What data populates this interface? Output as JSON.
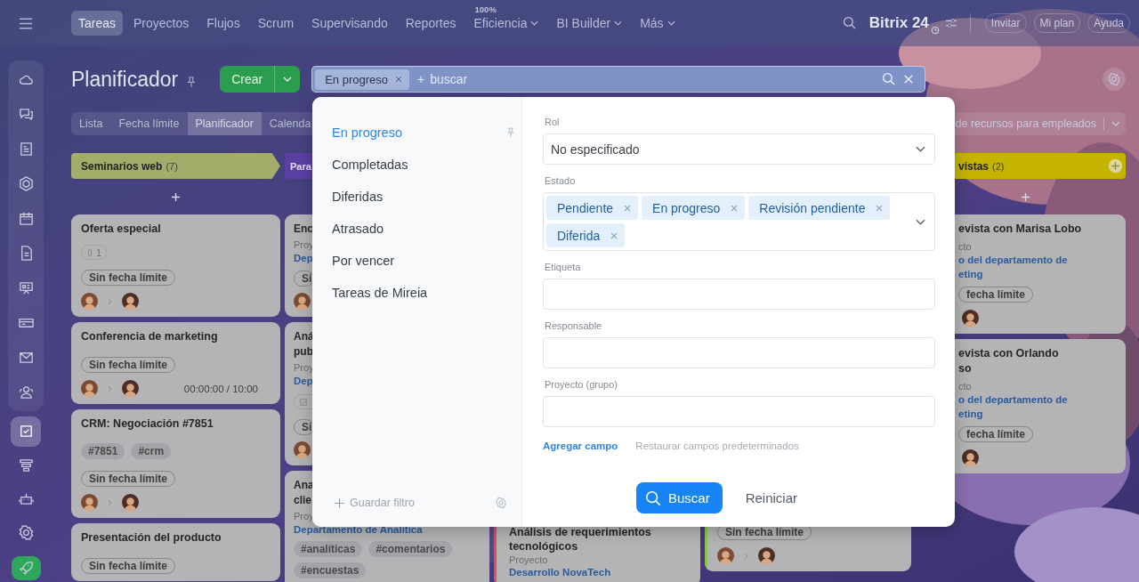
{
  "top_nav": {
    "tabs": [
      {
        "label": "Tareas",
        "selected": true,
        "dropdown": false
      },
      {
        "label": "Proyectos",
        "selected": false,
        "dropdown": false
      },
      {
        "label": "Flujos",
        "selected": false,
        "dropdown": false
      },
      {
        "label": "Scrum",
        "selected": false,
        "dropdown": false
      },
      {
        "label": "Supervisando",
        "selected": false,
        "dropdown": false
      },
      {
        "label": "Reportes",
        "selected": false,
        "dropdown": false
      },
      {
        "label": "Eficiencia",
        "badge": "100%",
        "selected": false,
        "dropdown": true
      },
      {
        "label": "BI Builder",
        "selected": false,
        "dropdown": true
      },
      {
        "label": "Más",
        "selected": false,
        "dropdown": true
      }
    ],
    "brand": "Bitrix 24",
    "buttons": [
      "Invitar",
      "Mi plan",
      "Ayuda"
    ]
  },
  "sidebar": {
    "items": [
      {
        "selected": false
      },
      {
        "selected": false
      },
      {
        "selected": false
      },
      {
        "selected": false
      },
      {
        "selected": false
      },
      {
        "selected": false
      },
      {
        "selected": false
      },
      {
        "selected": false
      },
      {
        "selected": false
      },
      {
        "selected": false
      },
      {
        "selected": true
      },
      {
        "selected": false
      },
      {
        "selected": false
      },
      {
        "selected": false
      },
      {
        "selected": false
      }
    ]
  },
  "header": {
    "title": "Planificador",
    "create_button": "Crear",
    "search": {
      "chips": [
        "En progreso"
      ],
      "plus": "+",
      "placeholder": "buscar"
    }
  },
  "views": {
    "tabs": [
      {
        "label": "Lista",
        "selected": false
      },
      {
        "label": "Fecha límite",
        "selected": false
      },
      {
        "label": "Planificador",
        "selected": true
      },
      {
        "label": "Calenda",
        "selected": false
      }
    ],
    "resource_selector": "de recursos para empleados"
  },
  "board": {
    "columns": [
      {
        "title": "Seminarios web",
        "count": "(7)",
        "color": "#a3ac69",
        "cards": [
          {
            "title_lines": [
              "Oferta especial"
            ],
            "attachments": "1",
            "deadline": "Sin fecha límite",
            "avatars": [
              {
                "kind": "creator"
              },
              {
                "kind": "responsible"
              }
            ]
          },
          {
            "title_lines": [
              "Conferencia de marketing"
            ],
            "deadline": "Sin fecha límite",
            "avatars": [
              {
                "kind": "creator"
              },
              {
                "kind": "responsible"
              }
            ],
            "timer": "00:00:00 / 10:00"
          },
          {
            "title_lines": [
              "CRM: Negociación #7851"
            ],
            "tags": [
              "#7851",
              "#crm"
            ],
            "deadline": "Sin fecha límite",
            "avatars": [
              {
                "kind": "creator"
              },
              {
                "kind": "responsible"
              }
            ]
          },
          {
            "title_lines": [
              "Presentación del producto"
            ],
            "deadline": "Sin fecha límite"
          }
        ]
      },
      {
        "title": "Para",
        "color": "#5b3fa3",
        "cards": [
          {
            "title_lines": [
              "Enc"
            ],
            "project_label": "Proy",
            "project_lines": [
              "Dep"
            ],
            "deadline": "Si",
            "avatars": [
              {
                "kind": "creator"
              }
            ]
          },
          {
            "title_lines": [
              "Aná",
              "pub"
            ],
            "project_label": "Proy",
            "project_lines": [
              "Dep"
            ],
            "checklist": true,
            "deadline": "Si",
            "avatars": [
              {
                "kind": "creator"
              }
            ]
          },
          {
            "title_lines": [
              "Ana",
              "clie"
            ],
            "project_label": "Proy",
            "project_lines": [
              "Departamento de Analítica"
            ],
            "tags": [
              "#analíticas",
              "#comentarios",
              "#encuestas"
            ]
          }
        ]
      },
      {
        "cards": [
          {
            "title_lines": [
              "Análisis de requerimientos",
              "tecnológicos"
            ],
            "project_label": "Proyecto",
            "project_lines": [
              "Desarrollo NovaTech"
            ],
            "color": "#d9534f"
          }
        ]
      },
      {
        "cards": [
          {
            "deadline": "Sin fecha límite",
            "avatars": [
              {
                "kind": "creator"
              },
              {
                "kind": "responsible"
              }
            ],
            "color": "#8bc34a"
          }
        ]
      },
      {
        "title": "vistas",
        "count": "(2)",
        "color": "#c4b400",
        "cards": [
          {
            "title_lines": [
              "evista con Marisa Lobo"
            ],
            "project_label": "cto",
            "project_lines": [
              "o del departamento de",
              "eting"
            ],
            "deadline": "fecha límite",
            "avatars": [
              {
                "kind": "responsible"
              }
            ]
          },
          {
            "title_lines": [
              "evista con Orlando",
              "so"
            ],
            "project_label": "cto",
            "project_lines": [
              "o del departamento de",
              "eting"
            ],
            "deadline": "fecha límite",
            "avatars": [
              {
                "kind": "responsible"
              }
            ]
          }
        ]
      }
    ]
  },
  "filter_popup": {
    "presets": [
      {
        "label": "En progreso",
        "selected": true,
        "pinned": true
      },
      {
        "label": "Completadas",
        "selected": false,
        "pinned": false
      },
      {
        "label": "Diferidas",
        "selected": false,
        "pinned": false
      },
      {
        "label": "Atrasado",
        "selected": false,
        "pinned": false
      },
      {
        "label": "Por vencer",
        "selected": false,
        "pinned": false
      },
      {
        "label": "Tareas de Mireia",
        "selected": false,
        "pinned": false
      }
    ],
    "save_filter": "Guardar filtro",
    "fields": [
      {
        "label": "Rol",
        "kind": "select",
        "value": "No especificado"
      },
      {
        "label": "Estado",
        "kind": "multiselect",
        "chips": [
          "Pendiente",
          "En progreso",
          "Revisión pendiente",
          "Diferida"
        ]
      },
      {
        "label": "Etiqueta",
        "kind": "text"
      },
      {
        "label": "Responsable",
        "kind": "text"
      },
      {
        "label": "Proyecto (grupo)",
        "kind": "text"
      }
    ],
    "add_field": "Agregar campo",
    "restore_fields": "Restaurar campos predeterminados",
    "search_button": "Buscar",
    "reset_button": "Reiniciar"
  }
}
